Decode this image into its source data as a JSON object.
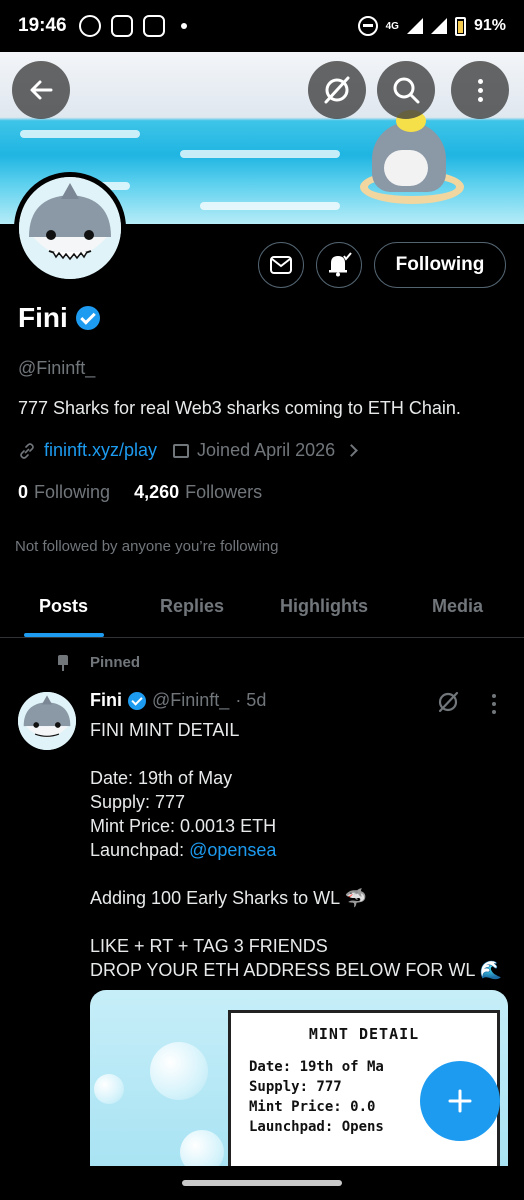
{
  "status_bar": {
    "time": "19:46",
    "network": "4G",
    "battery": "91%"
  },
  "header": {
    "back_icon": "arrow-left-icon",
    "actions": [
      "no-signal-icon",
      "search-icon",
      "more-vertical-icon"
    ]
  },
  "profile": {
    "name": "Fini",
    "handle": "@Fininft_",
    "bio": "777 Sharks for real Web3 sharks coming to ETH Chain.",
    "website": "fininft.xyz/play",
    "joined": "Joined April 2026",
    "following_count": "0",
    "following_label": "Following",
    "followers_count": "4,260",
    "followers_label": "Followers",
    "not_followed_text": "Not followed by anyone you’re following",
    "follow_button_label": "Following"
  },
  "tabs": [
    {
      "label": "Posts",
      "active": true
    },
    {
      "label": "Replies",
      "active": false
    },
    {
      "label": "Highlights",
      "active": false
    },
    {
      "label": "Media",
      "active": false
    }
  ],
  "post": {
    "pinned_label": "Pinned",
    "author_name": "Fini",
    "author_handle": "@Fininft_",
    "time": "· 5d",
    "lines": [
      "FINI MINT DETAIL",
      "",
      "Date: 19th of May",
      "Supply: 777",
      "Mint Price: 0.0013 ETH",
      "Launchpad: ",
      "",
      "Adding 100 Early Sharks to WL 🦈",
      "",
      "LIKE + RT + TAG 3 FRIENDS",
      "DROP YOUR ETH ADDRESS BELOW FOR WL 🌊"
    ],
    "mention": "@opensea",
    "image_card": {
      "title": "MINT DETAIL",
      "lines": [
        "Date: 19th of Ma",
        "Supply: 777",
        "Mint Price: 0.0",
        "Launchpad: Opens"
      ]
    }
  },
  "colors": {
    "accent": "#1d9bf0",
    "muted": "#71767b",
    "background": "#000000"
  }
}
